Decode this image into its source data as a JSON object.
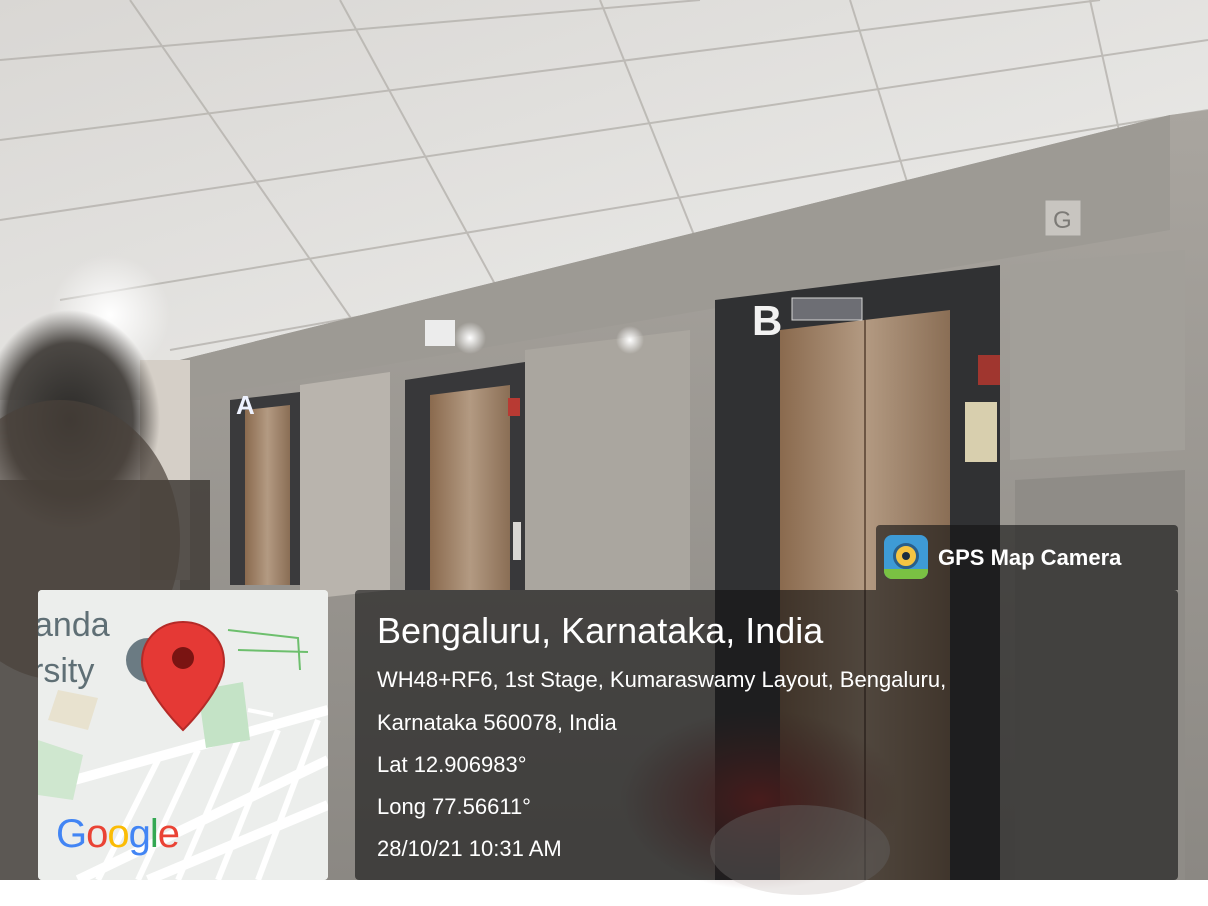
{
  "overlay": {
    "brand": {
      "icon": "gps-map-camera-icon",
      "label": "GPS Map Camera"
    },
    "location": {
      "city": "Bengaluru, Karnataka, India",
      "address_line1": "WH48+RF6, 1st Stage, Kumaraswamy Layout, Bengaluru,",
      "address_line2": "Karnataka 560078, India",
      "latitude": "Lat 12.906983°",
      "longitude": "Long 77.56611°",
      "timestamp": "28/10/21 10:31 AM"
    },
    "map": {
      "label_line1": "anda",
      "label_line2": "rsity",
      "logo": "Google",
      "pin_icon": "map-pin-icon"
    }
  },
  "scene": {
    "elevator_signs": [
      "A",
      "B",
      "G"
    ],
    "colors": {
      "pin": "#e53935",
      "panel": "#141414"
    }
  }
}
